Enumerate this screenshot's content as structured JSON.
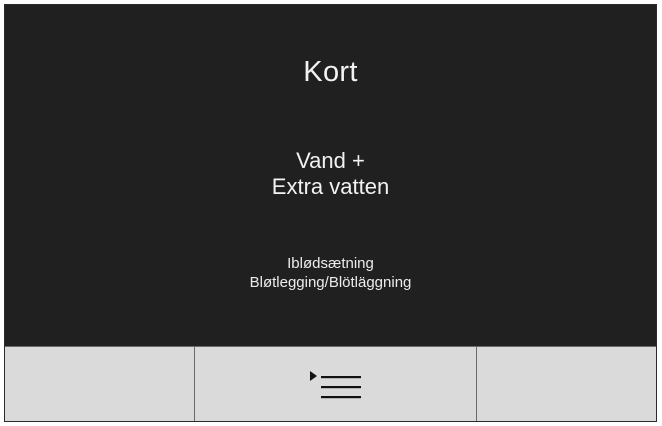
{
  "display": {
    "title": "Kort",
    "program": {
      "line1": "Vand +",
      "line2": "Extra vatten"
    },
    "option": {
      "line1": "Iblødsætning",
      "line2": "Bløtlegging/Blötläggning"
    }
  },
  "softkeys": {
    "left": {
      "label": ""
    },
    "middle": {
      "icon": "menu-icon"
    },
    "right": {
      "label": ""
    }
  },
  "colors": {
    "screen_background": "#202020",
    "text": "#f2f2f2",
    "softkey_background": "#dadada",
    "divider": "#6a6a6a"
  }
}
